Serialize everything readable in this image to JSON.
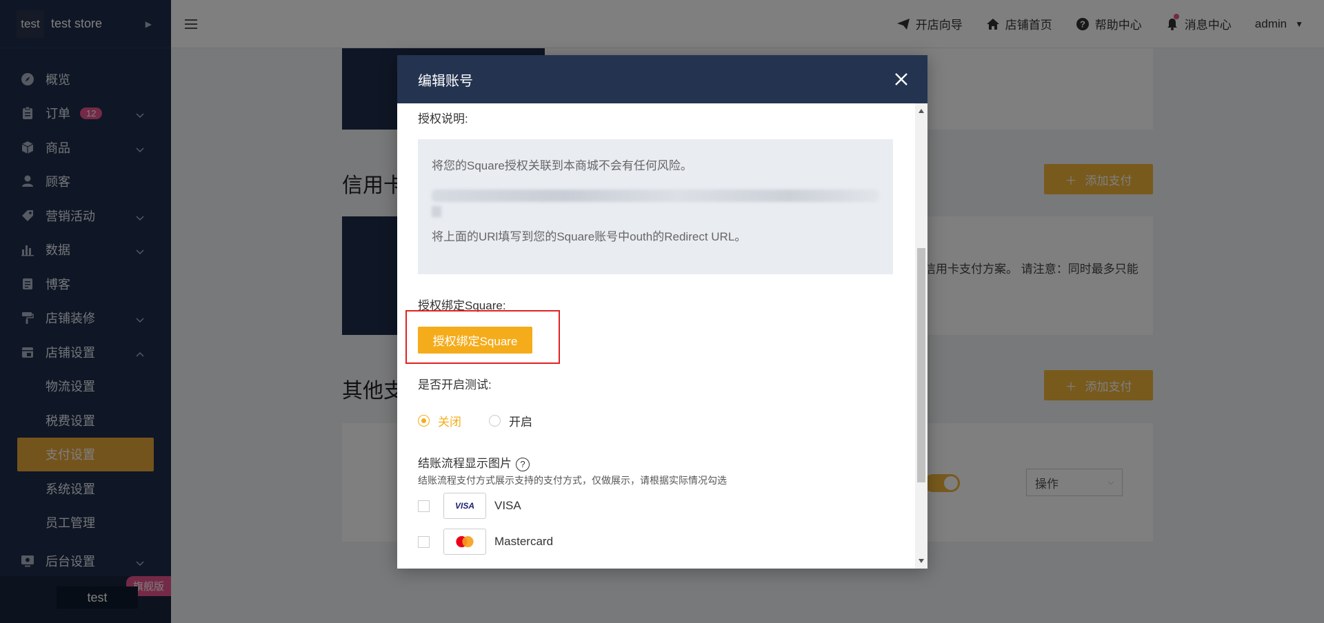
{
  "sidebar": {
    "logo": "test",
    "store_name": "test store",
    "items": [
      {
        "label": "概览",
        "icon": "compass-icon"
      },
      {
        "label": "订单",
        "icon": "clipboard-icon",
        "badge": "12"
      },
      {
        "label": "商品",
        "icon": "box-icon"
      },
      {
        "label": "顾客",
        "icon": "user-icon"
      },
      {
        "label": "营销活动",
        "icon": "tag-icon"
      },
      {
        "label": "数据",
        "icon": "bar-chart-icon"
      },
      {
        "label": "博客",
        "icon": "document-icon"
      },
      {
        "label": "店铺装修",
        "icon": "paint-roller-icon"
      },
      {
        "label": "店铺设置",
        "icon": "store-icon"
      },
      {
        "label": "后台设置",
        "icon": "monitor-icon"
      }
    ],
    "sub_items": [
      "物流设置",
      "税费设置",
      "支付设置",
      "系统设置",
      "员工管理"
    ],
    "user": "test",
    "plan_badge": "旗舰版"
  },
  "topbar": {
    "links": [
      {
        "label": "开店向导",
        "icon": "paper-plane-icon"
      },
      {
        "label": "店铺首页",
        "icon": "home-icon"
      },
      {
        "label": "帮助中心",
        "icon": "help-circle-icon"
      },
      {
        "label": "消息中心",
        "icon": "bell-icon"
      }
    ],
    "user": "admin"
  },
  "main": {
    "section_credit": "信用卡",
    "section_other": "其他支",
    "add_payment": "添加支付",
    "credit_desc_fragment": "信用卡支付方案。 请注意：同时最多只能",
    "action_select": "操作"
  },
  "modal": {
    "title": "编辑账号",
    "auth_note_label": "授权说明:",
    "auth_note_line1": "将您的Square授权关联到本商城不会有任何风险。",
    "auth_note_line3": "将上面的URl填写到您的Square账号中outh的Redirect URL。",
    "bind_label": "授权绑定Square:",
    "bind_button": "授权绑定Square",
    "test_label": "是否开启测试:",
    "test_off": "关闭",
    "test_on": "开启",
    "test_selected": "关闭",
    "checkout_label": "结账流程显示图片",
    "checkout_desc": "结账流程支付方式展示支持的支付方式，仅做展示，请根据实际情况勾选",
    "cards": [
      {
        "name": "VISA",
        "icon": "visa-logo-icon"
      },
      {
        "name": "Mastercard",
        "icon": "mastercard-logo-icon"
      }
    ]
  },
  "colors": {
    "sidebar_bg": "#1f2d4a",
    "accent": "#f5ac1b",
    "badge": "#e8548c",
    "highlight_box": "#e02020"
  }
}
